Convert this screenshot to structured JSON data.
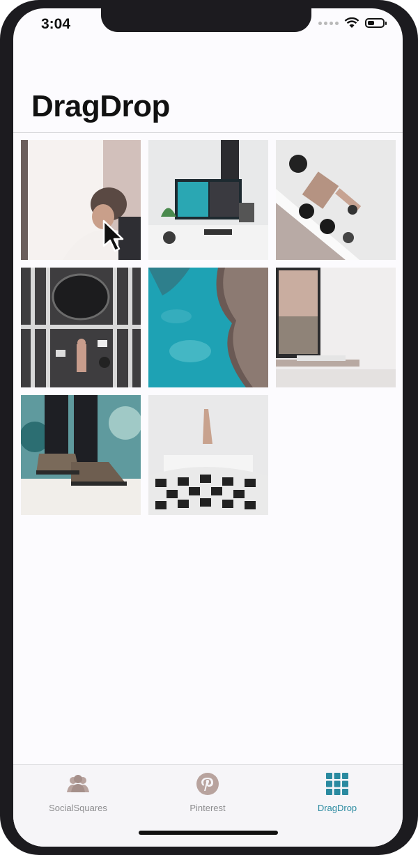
{
  "status_bar": {
    "time": "3:04"
  },
  "nav": {
    "title": "DragDrop"
  },
  "photos": [
    {
      "subject": "man in chair by window"
    },
    {
      "subject": "desk with monitor"
    },
    {
      "subject": "sunglasses and watches flat-lay"
    },
    {
      "subject": "person lying on floor with items"
    },
    {
      "subject": "aerial turquoise coastline"
    },
    {
      "subject": "monitor with landscape"
    },
    {
      "subject": "sneakers on snow"
    },
    {
      "subject": "person in bed with checkered blanket"
    }
  ],
  "tabs": [
    {
      "label": "SocialSquares",
      "icon": "people-icon"
    },
    {
      "label": "Pinterest",
      "icon": "pinterest-icon"
    },
    {
      "label": "DragDrop",
      "icon": "grid-icon"
    }
  ],
  "colors": {
    "accent": "#2a8aa0",
    "inactive": "#8d8d8f"
  }
}
